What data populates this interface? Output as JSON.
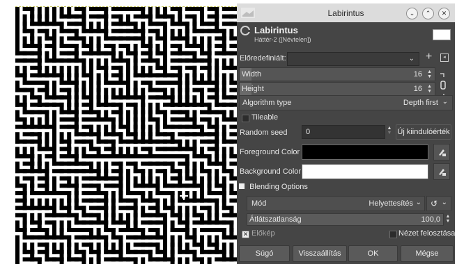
{
  "dialog": {
    "window_title": "Labirintus",
    "plugin_title": "Labirintus",
    "plugin_subtitle": "Háttér-2 ([Névtelen])"
  },
  "presets": {
    "label": "Előredefiniált:",
    "value": ""
  },
  "width": {
    "label": "Width",
    "value": "16",
    "fraction": 0.06
  },
  "height": {
    "label": "Height",
    "value": "16",
    "fraction": 0.06
  },
  "algorithm": {
    "label": "Algorithm type",
    "value": "Depth first"
  },
  "tileable": {
    "label": "Tileable",
    "checked": false
  },
  "seed": {
    "label": "Random seed",
    "value": "0",
    "new_seed_label": "Új kiindulóérték"
  },
  "foreground": {
    "label": "Foreground Color",
    "color": "#000000"
  },
  "background": {
    "label": "Background Color",
    "color": "#ffffff"
  },
  "blending": {
    "section_label": "Blending Options",
    "mode_label": "Mód",
    "mode_value": "Helyettesítés",
    "opacity_label": "Átlátszatlanság",
    "opacity_value": "100,0"
  },
  "preview": {
    "label": "Előkép",
    "checked": true
  },
  "split_view": {
    "label": "Nézet felosztása",
    "checked": false
  },
  "buttons": {
    "help": "Súgó",
    "reset": "Visszaállítás",
    "ok": "OK",
    "cancel": "Mégse"
  },
  "colors": {
    "dialog_bg": "#454545",
    "titlebar": "#dcdcdc",
    "field_bg": "#333333"
  },
  "icons": [
    "gimp-logo-icon",
    "minimize-icon",
    "maximize-icon",
    "close-icon",
    "add-preset-icon",
    "manage-presets-icon",
    "chain-link-icon",
    "color-picker-icon",
    "reset-icon",
    "cross-pointer-icon"
  ]
}
